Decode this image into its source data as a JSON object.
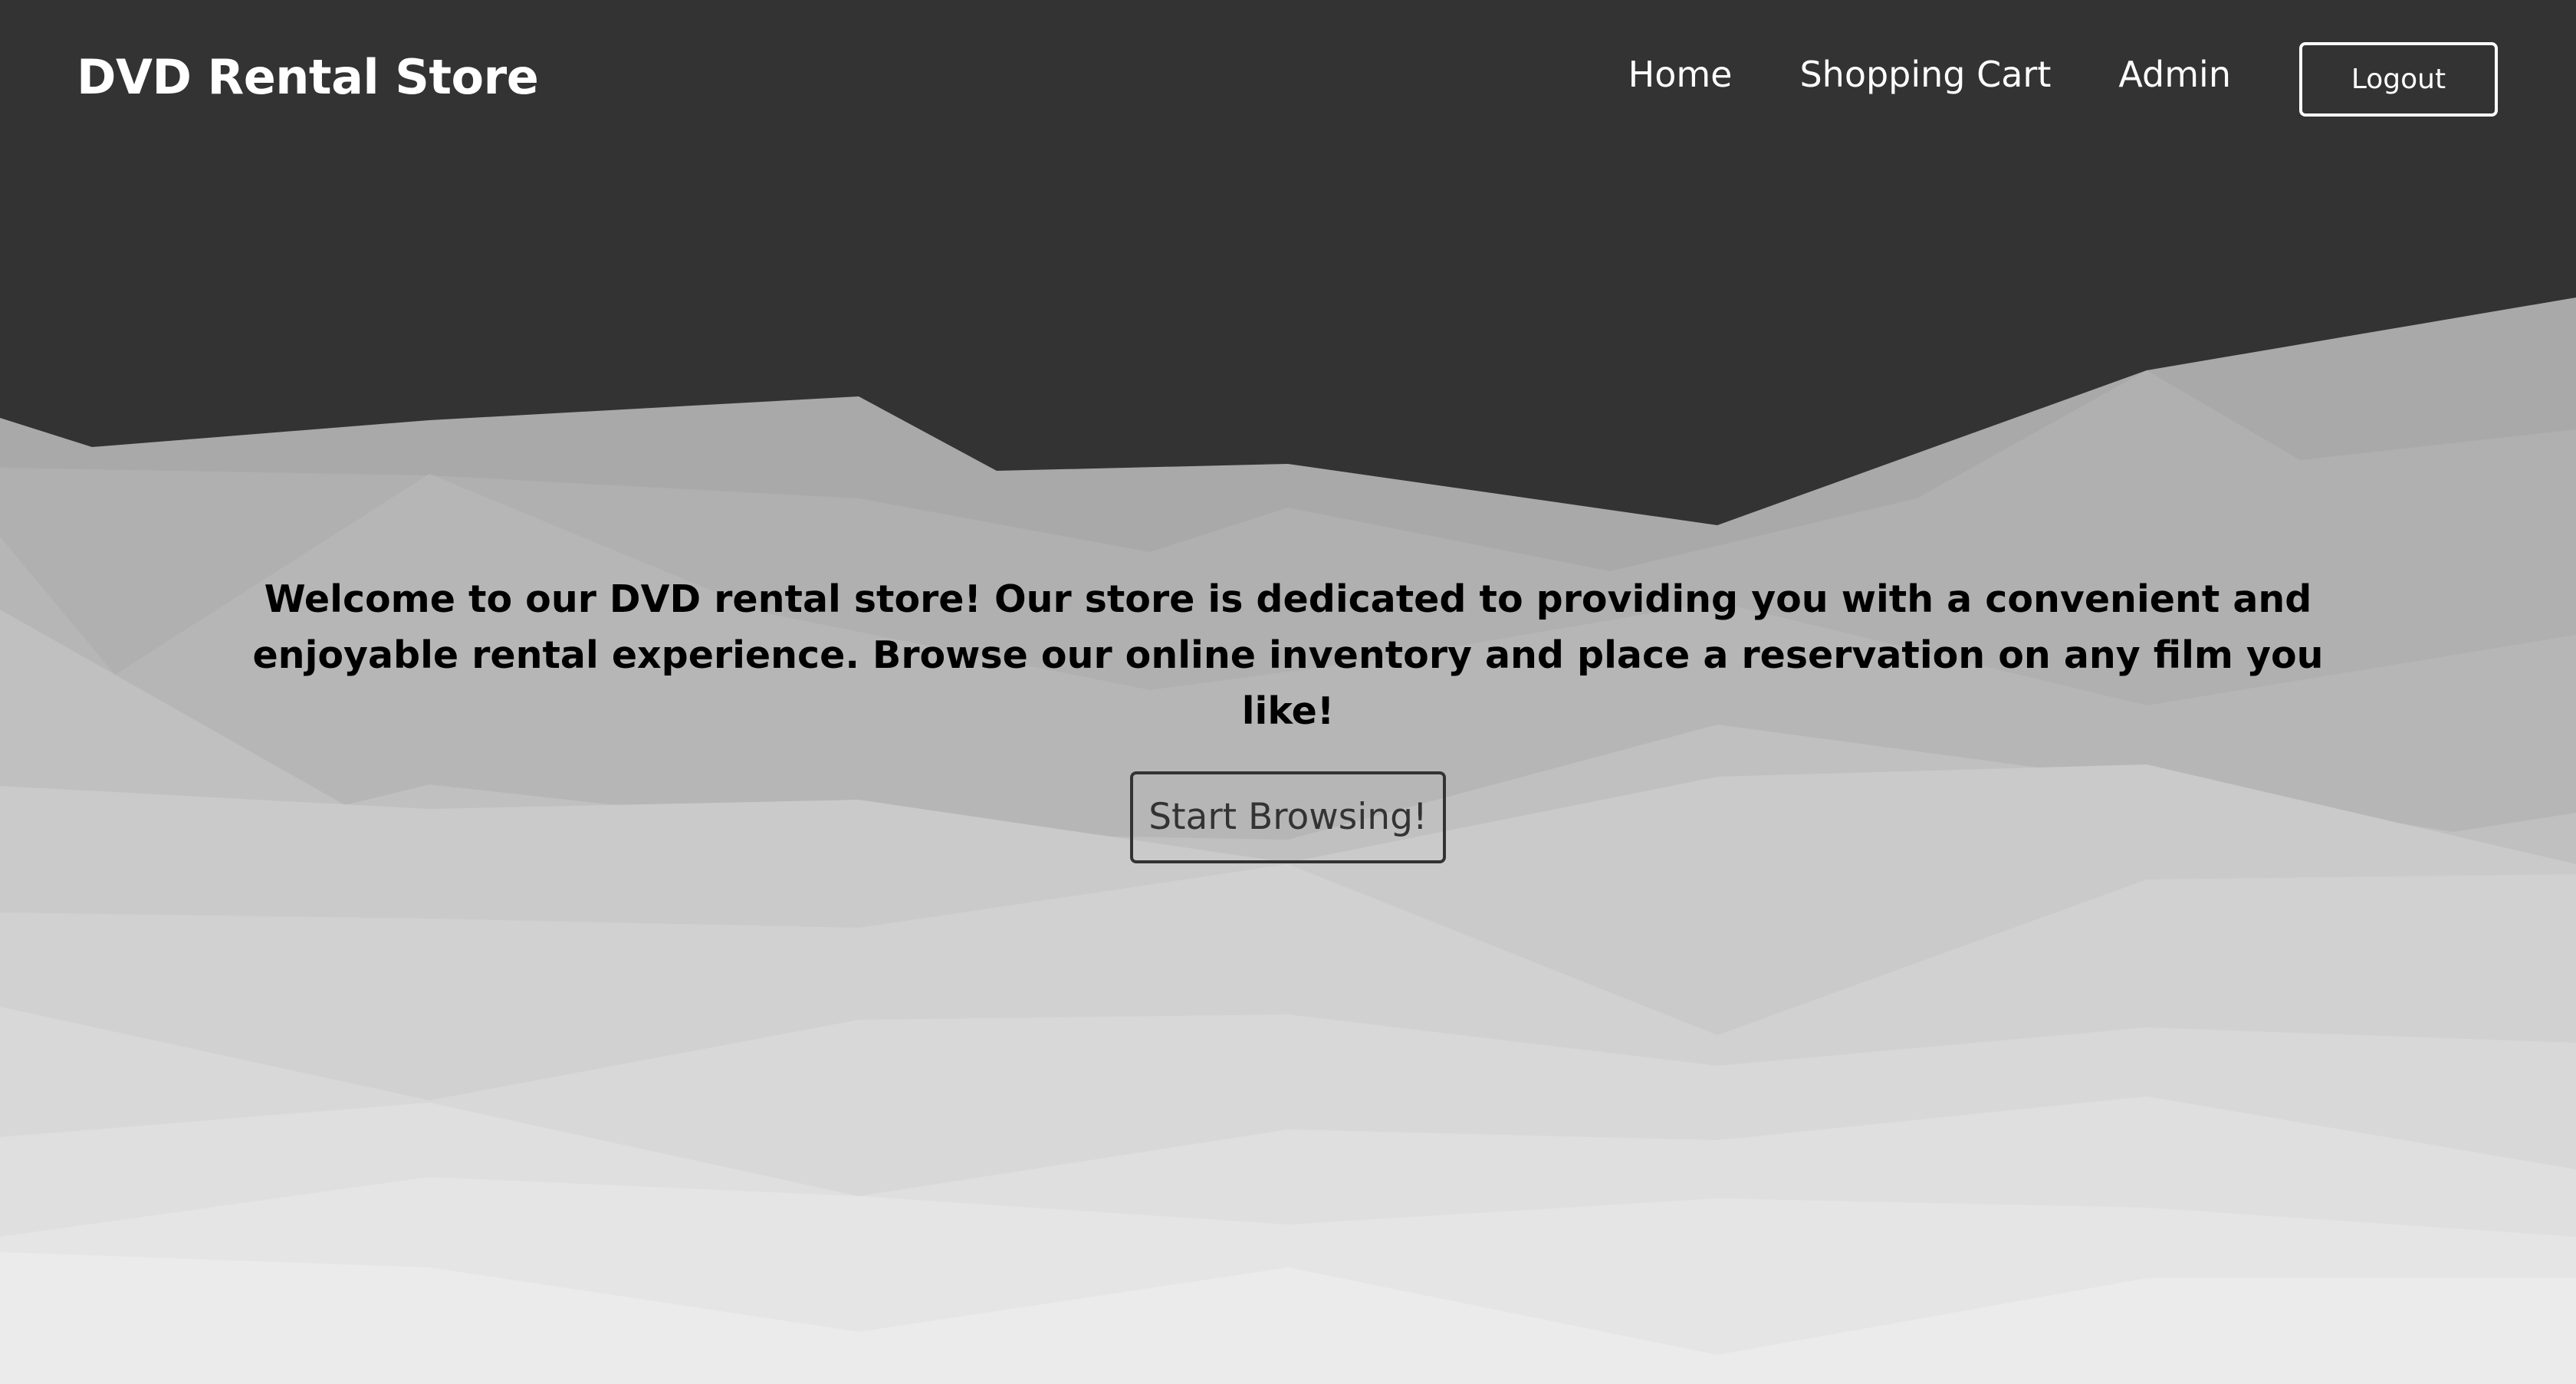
{
  "header": {
    "brand": "DVD Rental Store",
    "nav": [
      {
        "label": "Home"
      },
      {
        "label": "Shopping Cart"
      },
      {
        "label": "Admin"
      }
    ],
    "logout_label": "Logout"
  },
  "hero": {
    "message": "Welcome to our DVD rental store! Our store is dedicated to providing you with a convenient and enjoyable rental experience. Browse our online inventory and place a reservation on any film you like!",
    "cta_label": "Start Browsing!"
  },
  "colors": {
    "header_bg": "#333333",
    "nav_text": "#ffffff",
    "hero_text": "#000000",
    "cta_border": "#333333"
  }
}
